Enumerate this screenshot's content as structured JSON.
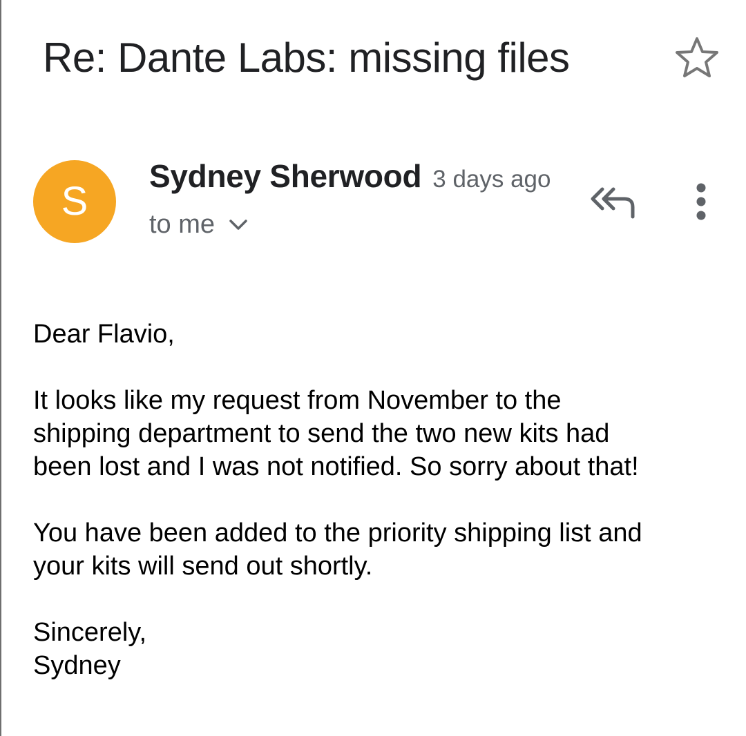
{
  "email": {
    "subject": "Re: Dante Labs: missing files",
    "star_icon": "star-outline-icon",
    "sender": {
      "avatar_letter": "S",
      "avatar_color": "#f6a623",
      "name": "Sydney Sherwood",
      "time": "3 days ago",
      "recipient": "to me"
    },
    "actions": {
      "reply_all_icon": "reply-all-icon",
      "more_icon": "more-vert-icon",
      "details_icon": "chevron-down-icon"
    },
    "body": {
      "greeting": "Dear Flavio,",
      "paragraph_1": "It looks like my request from November to the\nshipping department to send the two new kits had\nbeen lost and I was not notified. So sorry about that!",
      "paragraph_2": "You have been added to the priority shipping list and\nyour kits will send out shortly.",
      "closing": "Sincerely,\nSydney"
    }
  }
}
